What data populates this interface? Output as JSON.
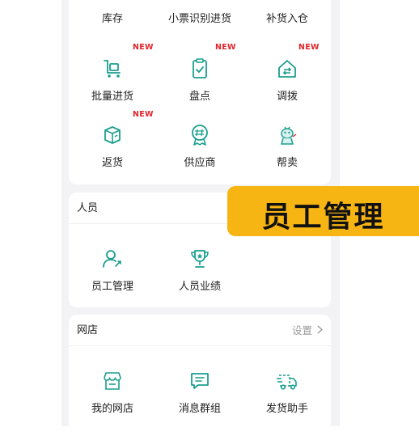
{
  "inventory_section": {
    "items": [
      {
        "label": "库存",
        "icon": "box-icon",
        "badge": ""
      },
      {
        "label": "小票识别进货",
        "icon": "scan-receipt-icon",
        "badge": ""
      },
      {
        "label": "补货入仓",
        "icon": "restock-icon",
        "badge": ""
      },
      {
        "label": "批量进货",
        "icon": "cart-icon",
        "badge": "NEW"
      },
      {
        "label": "盘点",
        "icon": "clipboard-check-icon",
        "badge": "NEW"
      },
      {
        "label": "调拨",
        "icon": "transfer-icon",
        "badge": "NEW"
      },
      {
        "label": "返货",
        "icon": "return-box-icon",
        "badge": "NEW"
      },
      {
        "label": "供应商",
        "icon": "supplier-badge-icon",
        "badge": ""
      },
      {
        "label": "帮卖",
        "icon": "mascot-icon",
        "badge": ""
      }
    ]
  },
  "staff_section": {
    "title": "人员",
    "items": [
      {
        "label": "员工管理",
        "icon": "staff-manage-icon"
      },
      {
        "label": "人员业绩",
        "icon": "trophy-icon"
      }
    ]
  },
  "shop_section": {
    "title": "网店",
    "action_label": "设置",
    "items": [
      {
        "label": "我的网店",
        "icon": "shop-icon"
      },
      {
        "label": "消息群组",
        "icon": "message-icon"
      },
      {
        "label": "发货助手",
        "icon": "delivery-truck-icon"
      }
    ]
  },
  "overlay_banner": {
    "text": "员工管理"
  },
  "colors": {
    "icon": "#1a9e8f",
    "badge": "#e0252b",
    "banner": "#f7b514"
  }
}
